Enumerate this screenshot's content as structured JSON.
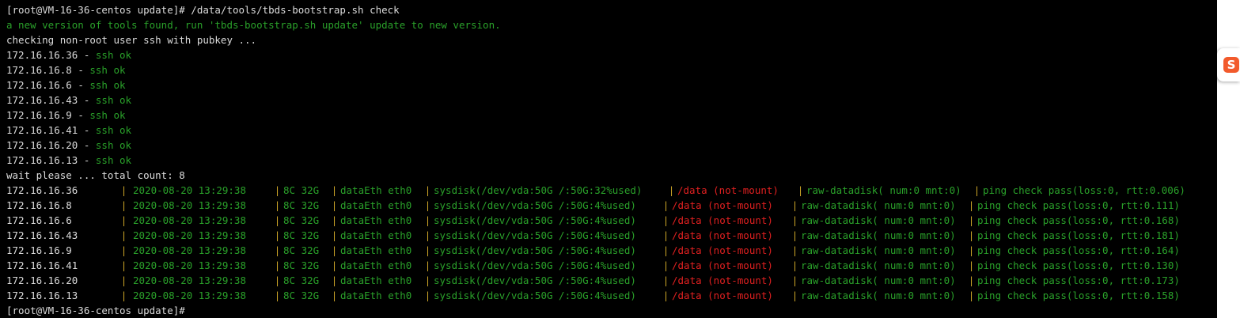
{
  "terminal": {
    "command_line": "[root@VM-16-36-centos update]# /data/tools/tbds-bootstrap.sh check",
    "update_notice": "a new version of tools found, run 'tbds-bootstrap.sh update' update to new version.",
    "checking_line": "checking non-root user ssh with pubkey ...",
    "ssh_results": [
      {
        "host": "172.16.16.36",
        "sep": " - ",
        "status": "ssh ok"
      },
      {
        "host": "172.16.16.8",
        "sep": " - ",
        "status": "ssh ok"
      },
      {
        "host": "172.16.16.6",
        "sep": " - ",
        "status": "ssh ok"
      },
      {
        "host": "172.16.16.43",
        "sep": " - ",
        "status": "ssh ok"
      },
      {
        "host": "172.16.16.9",
        "sep": " - ",
        "status": "ssh ok"
      },
      {
        "host": "172.16.16.41",
        "sep": " - ",
        "status": "ssh ok"
      },
      {
        "host": "172.16.16.20",
        "sep": " - ",
        "status": "ssh ok"
      },
      {
        "host": "172.16.16.13",
        "sep": " - ",
        "status": "ssh ok"
      }
    ],
    "wait_line": "wait please ... total count: 8",
    "separator": "|",
    "check_rows": [
      {
        "host": "172.16.16.36",
        "time": "2020-08-20 13:29:38",
        "spec": "8C 32G",
        "net": "dataEth eth0",
        "sysdisk": "sysdisk(/dev/vda:50G /:50G:32%used)",
        "data": "/data (not-mount)",
        "raw": "raw-datadisk( num:0 mnt:0)",
        "ping": "ping check pass(loss:0, rtt:0.006)"
      },
      {
        "host": "172.16.16.8",
        "time": "2020-08-20 13:29:38",
        "spec": "8C 32G",
        "net": "dataEth eth0",
        "sysdisk": "sysdisk(/dev/vda:50G /:50G:4%used)",
        "data": "/data (not-mount)",
        "raw": "raw-datadisk( num:0 mnt:0)",
        "ping": "ping check pass(loss:0, rtt:0.111)"
      },
      {
        "host": "172.16.16.6",
        "time": "2020-08-20 13:29:38",
        "spec": "8C 32G",
        "net": "dataEth eth0",
        "sysdisk": "sysdisk(/dev/vda:50G /:50G:4%used)",
        "data": "/data (not-mount)",
        "raw": "raw-datadisk( num:0 mnt:0)",
        "ping": "ping check pass(loss:0, rtt:0.168)"
      },
      {
        "host": "172.16.16.43",
        "time": "2020-08-20 13:29:38",
        "spec": "8C 32G",
        "net": "dataEth eth0",
        "sysdisk": "sysdisk(/dev/vda:50G /:50G:4%used)",
        "data": "/data (not-mount)",
        "raw": "raw-datadisk( num:0 mnt:0)",
        "ping": "ping check pass(loss:0, rtt:0.181)"
      },
      {
        "host": "172.16.16.9",
        "time": "2020-08-20 13:29:38",
        "spec": "8C 32G",
        "net": "dataEth eth0",
        "sysdisk": "sysdisk(/dev/vda:50G /:50G:4%used)",
        "data": "/data (not-mount)",
        "raw": "raw-datadisk( num:0 mnt:0)",
        "ping": "ping check pass(loss:0, rtt:0.164)"
      },
      {
        "host": "172.16.16.41",
        "time": "2020-08-20 13:29:38",
        "spec": "8C 32G",
        "net": "dataEth eth0",
        "sysdisk": "sysdisk(/dev/vda:50G /:50G:4%used)",
        "data": "/data (not-mount)",
        "raw": "raw-datadisk( num:0 mnt:0)",
        "ping": "ping check pass(loss:0, rtt:0.130)"
      },
      {
        "host": "172.16.16.20",
        "time": "2020-08-20 13:29:38",
        "spec": "8C 32G",
        "net": "dataEth eth0",
        "sysdisk": "sysdisk(/dev/vda:50G /:50G:4%used)",
        "data": "/data (not-mount)",
        "raw": "raw-datadisk( num:0 mnt:0)",
        "ping": "ping check pass(loss:0, rtt:0.173)"
      },
      {
        "host": "172.16.16.13",
        "time": "2020-08-20 13:29:38",
        "spec": "8C 32G",
        "net": "dataEth eth0",
        "sysdisk": "sysdisk(/dev/vda:50G /:50G:4%used)",
        "data": "/data (not-mount)",
        "raw": "raw-datadisk( num:0 mnt:0)",
        "ping": "ping check pass(loss:0, rtt:0.158)"
      }
    ],
    "final_prompt": "[root@VM-16-36-centos update]#"
  },
  "ime_badge": {
    "logo_text": "S",
    "icon": "sogou-ime-icon"
  },
  "colors": {
    "background": "#000000",
    "ok_green": "#2aa12a",
    "error_red": "#e02020",
    "separator_yellow": "#c9a227",
    "text": "#d8d8d8",
    "ime_orange": "#f25a2c"
  }
}
